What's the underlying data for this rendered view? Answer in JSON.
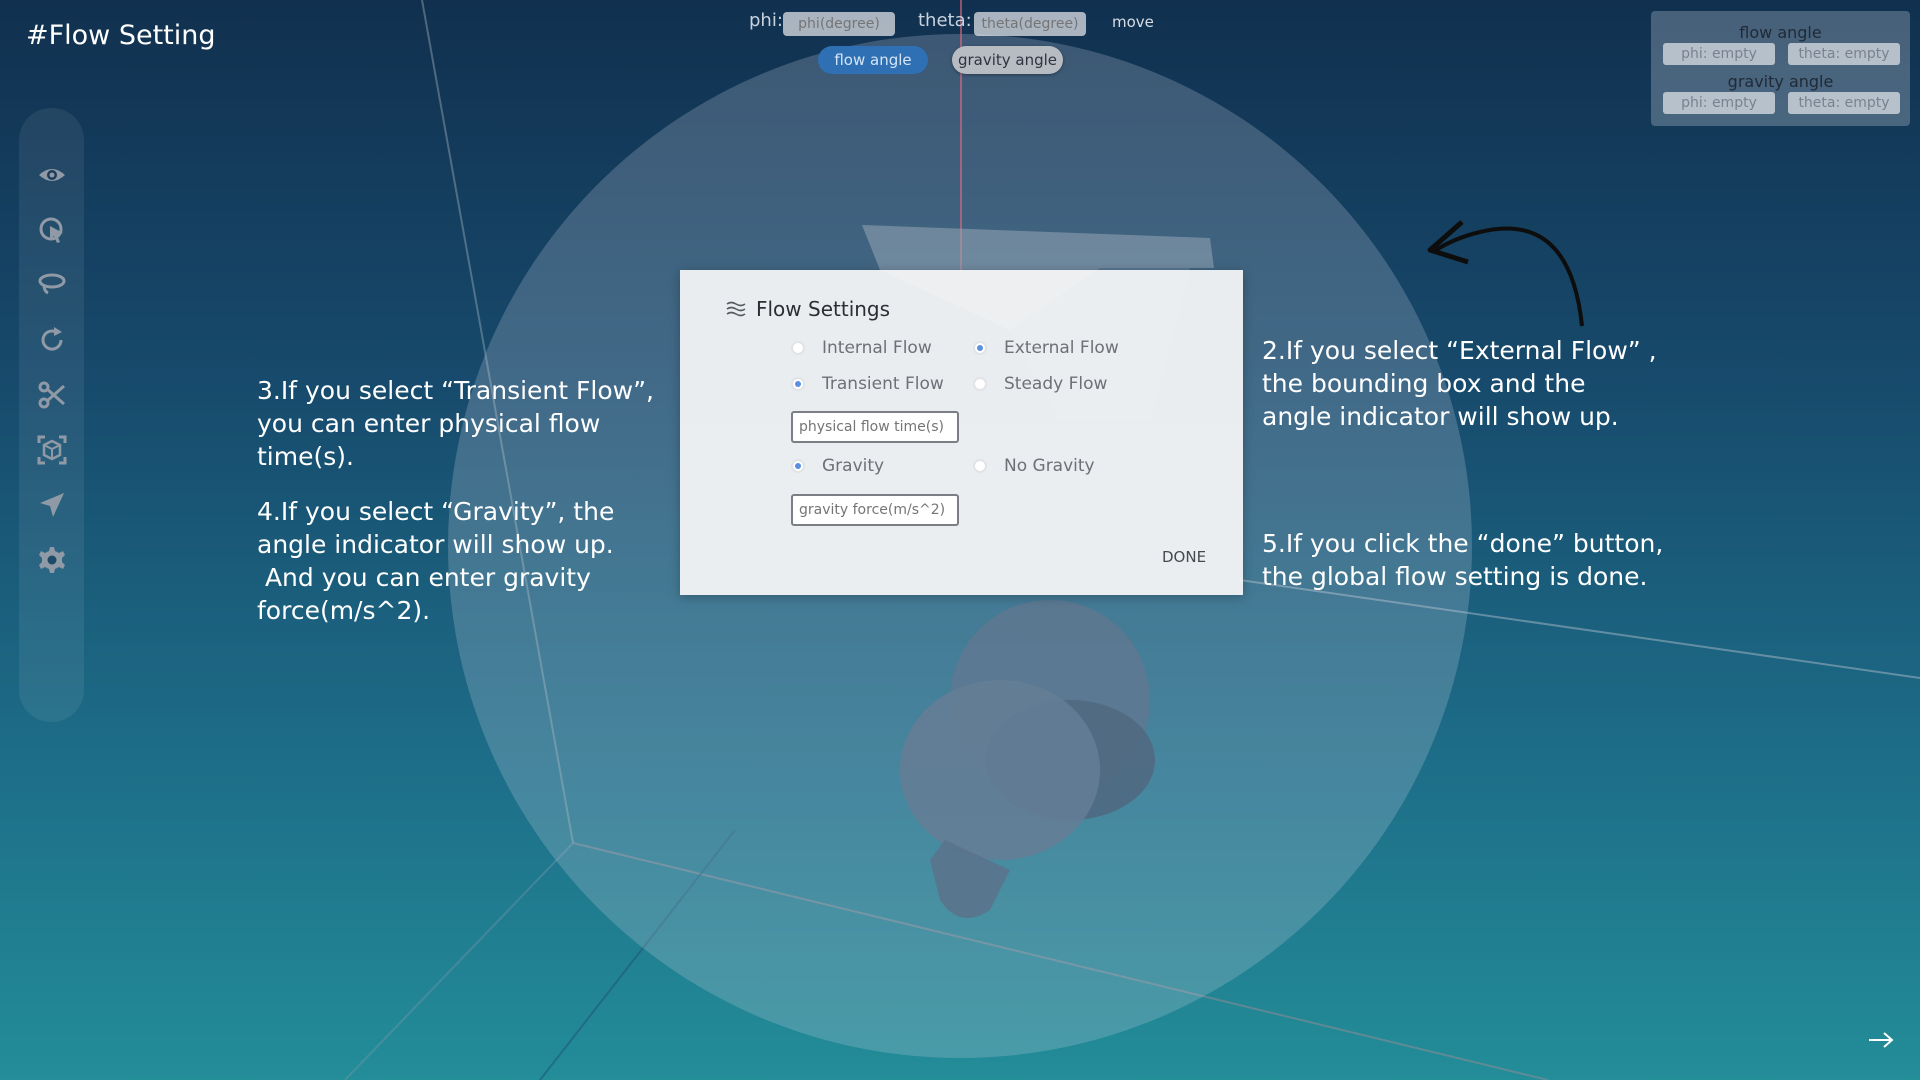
{
  "page": {
    "title": "#Flow Setting"
  },
  "sidebar": {
    "tools": [
      {
        "icon": "eye-icon"
      },
      {
        "icon": "cursor-select-icon"
      },
      {
        "icon": "lasso-icon"
      },
      {
        "icon": "rotate-icon"
      },
      {
        "icon": "scissors-icon"
      },
      {
        "icon": "bounding-box-icon"
      },
      {
        "icon": "send-icon"
      },
      {
        "icon": "gear-icon"
      }
    ]
  },
  "topbar": {
    "phi_label": "phi:",
    "phi_placeholder": "phi(degree)",
    "theta_label": "theta:",
    "theta_placeholder": "theta(degree)",
    "move_label": "move",
    "flow_angle_button": "flow angle",
    "gravity_angle_button": "gravity angle"
  },
  "angle_panel": {
    "flow_header": "flow angle",
    "flow_phi": "phi: empty",
    "flow_theta": "theta: empty",
    "gravity_header": "gravity angle",
    "gravity_phi": "phi: empty",
    "gravity_theta": "theta: empty"
  },
  "dialog": {
    "title": "Flow Settings",
    "options": {
      "internal_flow": "Internal Flow",
      "external_flow": "External Flow",
      "transient_flow": "Transient Flow",
      "steady_flow": "Steady Flow",
      "gravity": "Gravity",
      "no_gravity": "No Gravity"
    },
    "selected": {
      "flow_domain": "External Flow",
      "time": "Transient Flow",
      "gravity": "Gravity"
    },
    "flow_time_placeholder": "physical flow time(s)",
    "gravity_force_placeholder": "gravity force(m/s^2)",
    "done_label": "DONE"
  },
  "annotations": {
    "note2": [
      "2.If you select “External Flow” ,",
      "the bounding box and the",
      "angle indicator will show up."
    ],
    "note3": [
      "3.If you select “Transient Flow”,",
      "you can enter physical flow",
      "time(s)."
    ],
    "note4": [
      "4.If you select “Gravity”,  the",
      "angle indicator will show up.",
      " And you can enter gravity",
      "force(m/s^2)."
    ],
    "note5": [
      "5.If you click the “done” button,",
      "the global flow setting is done."
    ]
  },
  "colors": {
    "accent_blue": "#2f6fb3",
    "radio_selected": "#5b8fe0",
    "background_top": "#11304f",
    "background_bottom": "#238d98"
  },
  "nav": {
    "next_icon": "arrow-right-icon"
  }
}
